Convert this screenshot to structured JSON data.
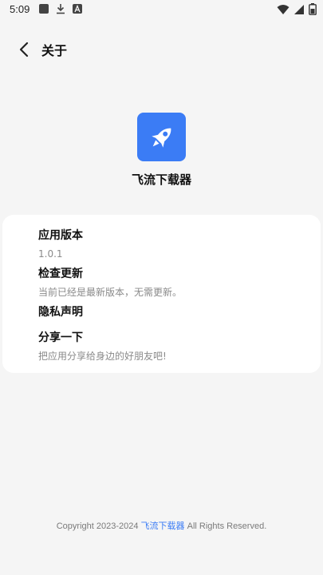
{
  "status_bar": {
    "time": "5:09",
    "left_icons": [
      "app-square-icon",
      "download-icon",
      "app-a-icon"
    ],
    "right_icons": [
      "wifi-icon",
      "signal-icon",
      "battery-icon"
    ]
  },
  "header": {
    "back_icon": "chevron-left-icon",
    "title": "关于"
  },
  "app": {
    "logo_icon": "rocket-icon",
    "logo_color": "#3b7cf5",
    "name": "飞流下载器"
  },
  "items": [
    {
      "title": "应用版本",
      "subtitle": "1.0.1"
    },
    {
      "title": "检查更新",
      "subtitle": "当前已经是最新版本，无需更新。"
    },
    {
      "title": "隐私声明",
      "subtitle": ""
    },
    {
      "title": "分享一下",
      "subtitle": "把应用分享给身边的好朋友吧!"
    }
  ],
  "footer": {
    "prefix": "Copyright 2023-2024",
    "link": "飞流下载器",
    "suffix": "All Rights Reserved."
  }
}
